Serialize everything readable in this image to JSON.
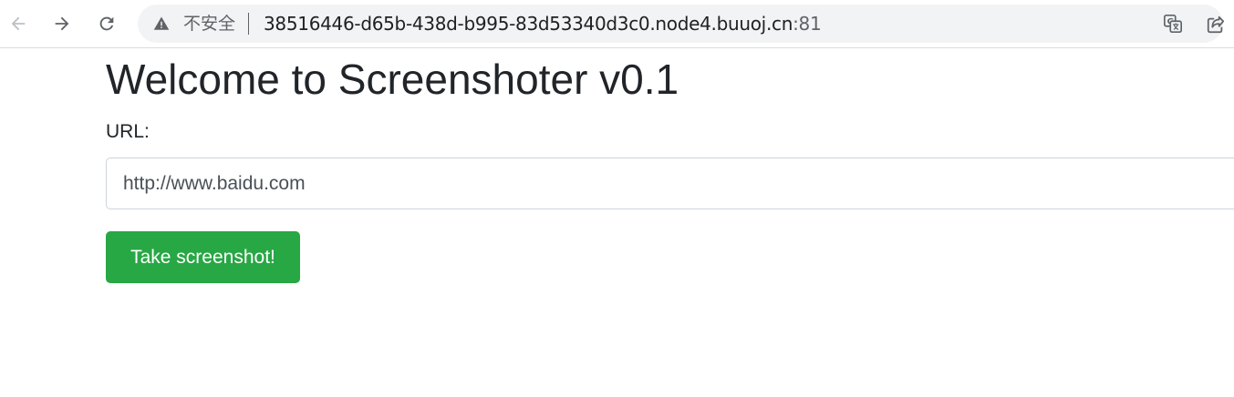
{
  "browser": {
    "security_label": "不安全",
    "url_host": "38516446-d65b-438d-b995-83d53340d3c0.node4.buuoj.cn",
    "url_port": ":81",
    "icons": {
      "back": "arrow-left-icon",
      "forward": "arrow-right-icon",
      "reload": "reload-icon",
      "warning": "warning-triangle-icon",
      "translate": "translate-icon",
      "share": "share-icon"
    }
  },
  "page": {
    "title": "Welcome to Screenshoter v0.1",
    "url_label": "URL:",
    "url_input_value": "http://www.baidu.com",
    "submit_label": "Take screenshot!",
    "colors": {
      "button_bg": "#28a745",
      "button_text": "#ffffff",
      "text": "#212529"
    }
  }
}
